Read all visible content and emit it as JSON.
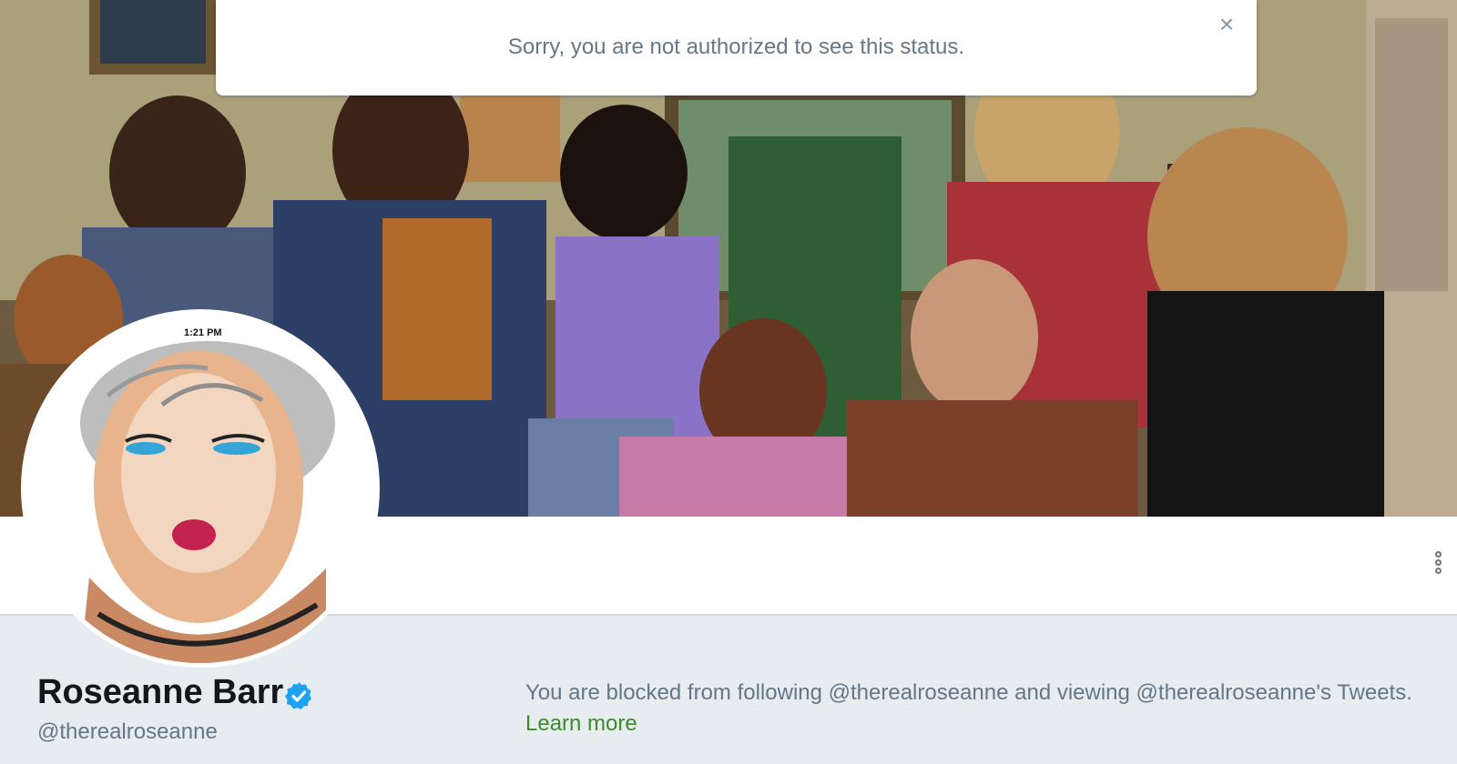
{
  "alert": {
    "message": "Sorry, you are not authorized to see this status.",
    "close_symbol": "×"
  },
  "avatar": {
    "time": "1:21 PM"
  },
  "profile": {
    "name": "Roseanne Barr",
    "handle": "@therealroseanne",
    "verified": true
  },
  "blocked_notice": {
    "message": "You are blocked from following @therealroseanne and viewing @therealroseanne's Tweets.",
    "link_label": "Learn more"
  },
  "icons": {
    "close": "close-icon",
    "verified": "verified-badge-icon",
    "more": "more-vertical-icon"
  },
  "colors": {
    "link": "#3f8a2a",
    "verified": "#1da1f2",
    "muted_text": "#657786",
    "background": "#e6ecf0"
  }
}
